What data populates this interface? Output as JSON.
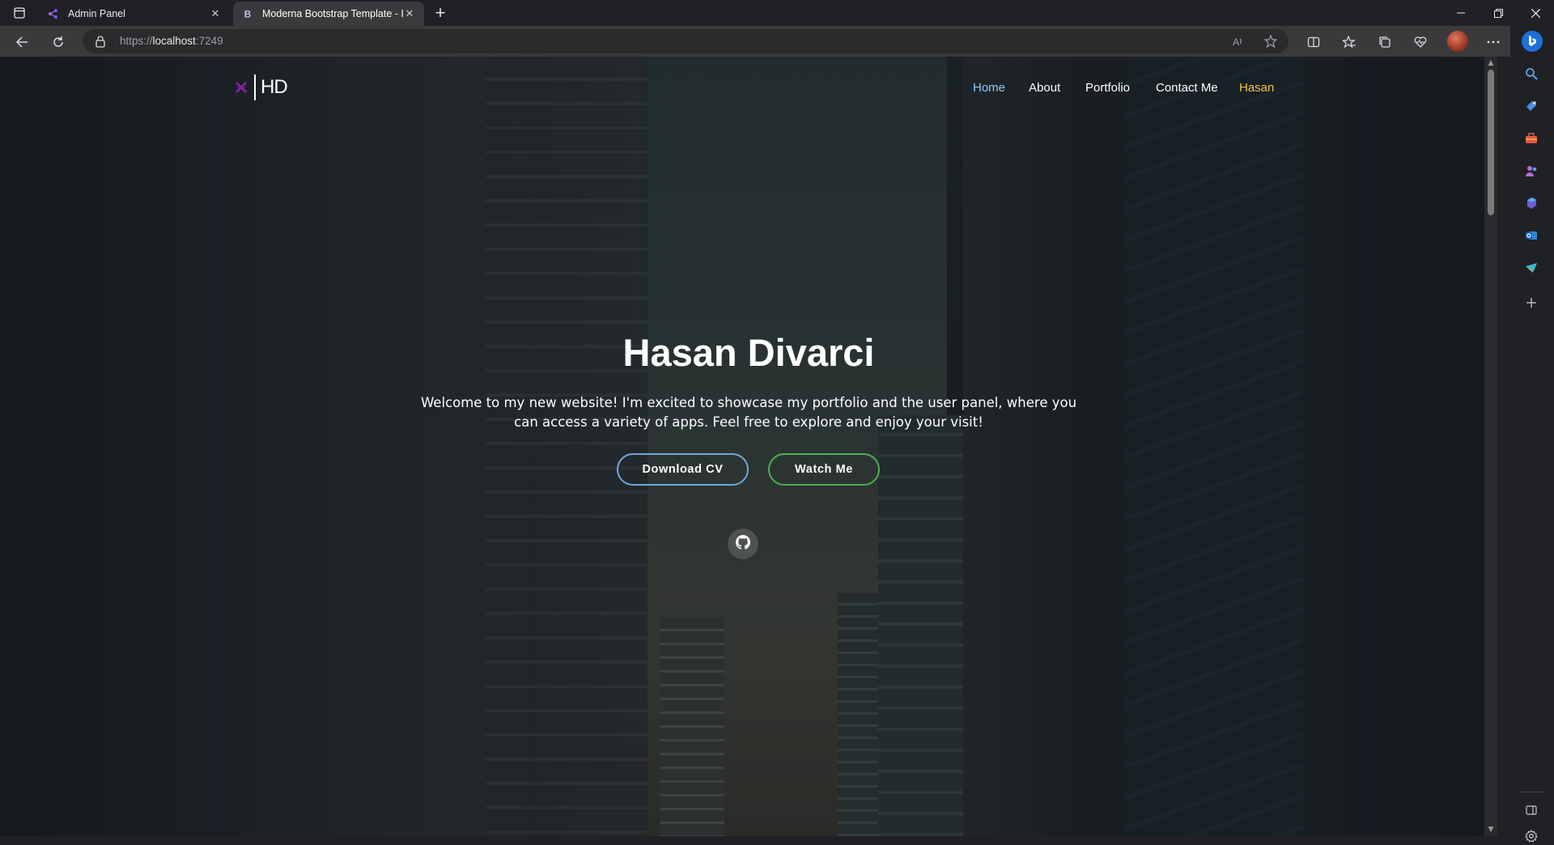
{
  "browser": {
    "tabs": [
      {
        "title": "Admin Panel",
        "favicon": "admin-panel-favicon",
        "active": false
      },
      {
        "title": "Moderna Bootstrap Template - I",
        "favicon": "B",
        "active": true
      }
    ],
    "address": {
      "scheme": "https://",
      "host": "localhost",
      "port": ":7249"
    },
    "toolbar_icons": [
      "read-aloud-icon",
      "favorite-star-icon",
      "split-screen-icon",
      "favorites-icon",
      "collections-icon",
      "browser-essentials-icon",
      "profile-avatar",
      "more-icon"
    ],
    "sidebar_icons": [
      "bing-copilot-icon",
      "search-icon",
      "shopping-icon",
      "tools-icon",
      "people-icon",
      "microsoft-365-icon",
      "outlook-icon",
      "send-icon",
      "add-icon",
      "sidebar-toggle-icon",
      "settings-icon"
    ]
  },
  "site": {
    "logo": {
      "letters": "HD"
    },
    "nav": [
      "Home",
      "About",
      "Portfolio",
      "Contact Me",
      "Hasan"
    ],
    "hero": {
      "title": "Hasan Divarci",
      "subtitle": "Welcome to my new website! I'm excited to showcase my portfolio and the user panel, where you can access a variety of apps. Feel free to explore and enjoy your visit!",
      "download_label": "Download CV",
      "watch_label": "Watch Me"
    },
    "colors": {
      "nav_active": "#90caf9",
      "nav_highlight": "#f5c242",
      "cv_border": "#6fa8dc",
      "watch_border": "#4caf50"
    }
  }
}
